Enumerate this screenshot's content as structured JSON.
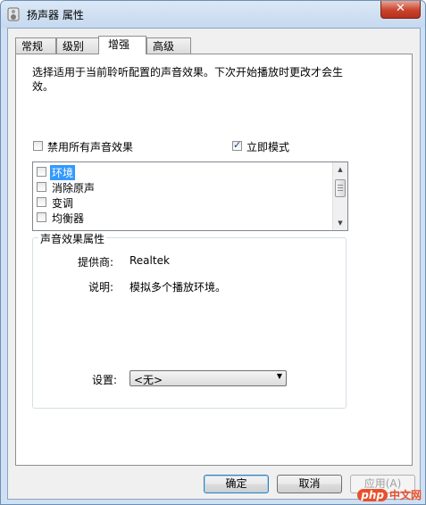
{
  "window": {
    "title": "扬声器 属性",
    "close_glyph": "✕"
  },
  "tabs": [
    {
      "label": "常规"
    },
    {
      "label": "级别"
    },
    {
      "label": "增强"
    },
    {
      "label": "高级"
    }
  ],
  "enhancements": {
    "description": "选择适用于当前聆听配置的声音效果。下次开始播放时更改才会生效。",
    "disable_all": {
      "label": "禁用所有声音效果",
      "checked": false
    },
    "immediate_mode": {
      "label": "立即模式",
      "checked": true
    },
    "effects": [
      {
        "label": "环境",
        "checked": false,
        "selected": true
      },
      {
        "label": "消除原声",
        "checked": false,
        "selected": false
      },
      {
        "label": "变调",
        "checked": false,
        "selected": false
      },
      {
        "label": "均衡器",
        "checked": false,
        "selected": false
      }
    ],
    "properties": {
      "title": "声音效果属性",
      "provider_label": "提供商:",
      "provider_value": "Realtek",
      "description_label": "说明:",
      "description_value": "模拟多个播放环境。",
      "settings_label": "设置:",
      "settings_value": "<无>"
    }
  },
  "buttons": {
    "ok": "确定",
    "cancel": "取消",
    "apply": "应用(A)"
  },
  "watermark": {
    "badge": "php",
    "text": "中文网"
  }
}
